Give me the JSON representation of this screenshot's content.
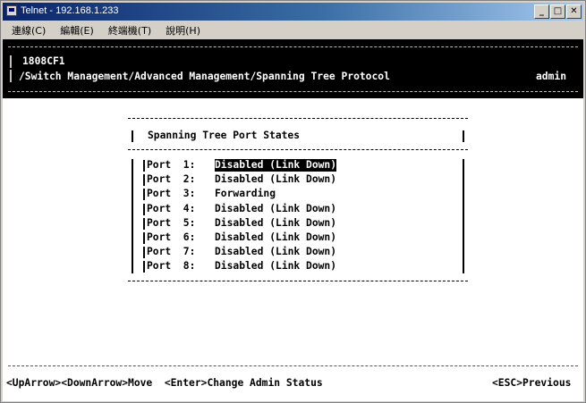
{
  "window": {
    "title": "Telnet - 192.168.1.233",
    "buttons": [
      "_",
      "□",
      "✕"
    ]
  },
  "menu": [
    "連線(C)",
    "編輯(E)",
    "終端機(T)",
    "說明(H)"
  ],
  "header": {
    "device": "1808CF1",
    "path": "/Switch Management/Advanced Management/Spanning Tree Protocol",
    "user": "admin"
  },
  "panel": {
    "title": "Spanning Tree Port States",
    "selected_index": 0,
    "ports": [
      {
        "label": "Port  1:",
        "state": "Disabled (Link Down)"
      },
      {
        "label": "Port  2:",
        "state": "Disabled (Link Down)"
      },
      {
        "label": "Port  3:",
        "state": "Forwarding"
      },
      {
        "label": "Port  4:",
        "state": "Disabled (Link Down)"
      },
      {
        "label": "Port  5:",
        "state": "Disabled (Link Down)"
      },
      {
        "label": "Port  6:",
        "state": "Disabled (Link Down)"
      },
      {
        "label": "Port  7:",
        "state": "Disabled (Link Down)"
      },
      {
        "label": "Port  8:",
        "state": "Disabled (Link Down)"
      }
    ]
  },
  "footer": {
    "left": "<UpArrow><DownArrow>Move  <Enter>Change Admin Status",
    "right": "<ESC>Previous"
  }
}
